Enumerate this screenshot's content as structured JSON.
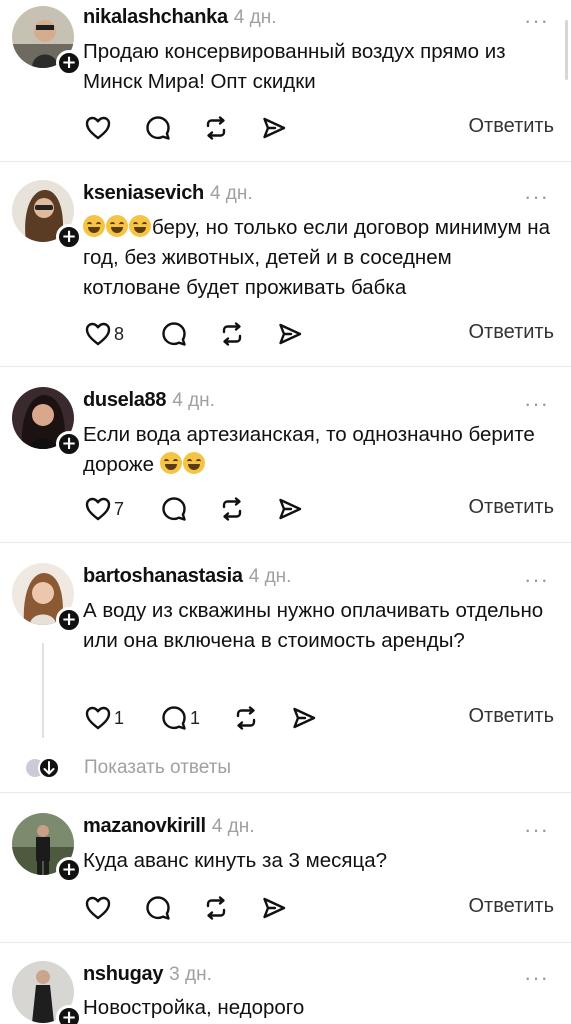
{
  "comments": [
    {
      "username": "nikalashchanka",
      "time": "4 дн.",
      "text": "Продаю консервированный воздух прямо из Минск Мира! Опт скидки",
      "likes": "",
      "replies": "",
      "reply_label": "Ответить"
    },
    {
      "username": "kseniasevich",
      "time": "4 дн.",
      "text": "беру, но только если договор минимум на год, без животных, детей и в соседнем котловане будет проживать бабка",
      "likes": "8",
      "replies": "",
      "reply_label": "Ответить"
    },
    {
      "username": "dusela88",
      "time": "4 дн.",
      "text": "Если вода артезианская,  то однозначно берите дороже",
      "likes": "7",
      "replies": "",
      "reply_label": "Ответить"
    },
    {
      "username": "bartoshanastasia",
      "time": "4 дн.",
      "text": "А воду из скважины нужно оплачивать отдельно или она включена в стоимость аренды?",
      "likes": "1",
      "replies": "1",
      "reply_label": "Ответить",
      "show_replies": "Показать ответы"
    },
    {
      "username": "mazanovkirill",
      "time": "4 дн.",
      "text": "Куда аванс кинуть за 3 месяца?",
      "likes": "",
      "replies": "",
      "reply_label": "Ответить"
    },
    {
      "username": "nshugay",
      "time": "3 дн.",
      "text": "Новостройка, недорого",
      "likes": "",
      "replies": "",
      "reply_label": ""
    }
  ],
  "icons": {
    "like": "heart-icon",
    "comment": "comment-bubble-icon",
    "repost": "repost-icon",
    "share": "send-icon",
    "more": "more-dots-icon",
    "follow": "plus-icon"
  },
  "more_label": "···"
}
